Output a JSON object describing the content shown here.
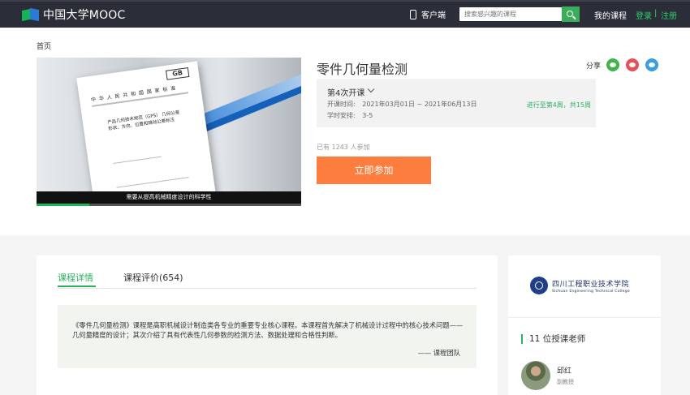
{
  "header": {
    "logo_text": "中国大学MOOC",
    "client_label": "客户端",
    "search_placeholder": "搜索感兴趣的课程",
    "my_courses": "我的课程",
    "login": "登录",
    "separator": "|",
    "register": "注册"
  },
  "breadcrumb": {
    "home": "首页"
  },
  "video": {
    "caption": "需要从提高机械精度设计的科学性",
    "progress_fraction": 0.2,
    "doc_badge": "GB",
    "doc_header": "中 华 人 民 共 和 国 国 家 标 准",
    "doc_subtitle": "产品几何技术规范（GPS） 几何公差 形状、方向、位置和跳动公差标注"
  },
  "course": {
    "title": "零件几何量检测",
    "share_label": "分享",
    "term_name": "第4次开课",
    "open_time_label": "开课时间:",
    "open_time_value": "2021年03月01日 ~ 2021年06月13日",
    "schedule_label": "学时安排:",
    "schedule_value": "3-5",
    "progress_text": "进行至第4周，共15周",
    "enrolled_text": "已有 1243 人参加",
    "join_button": "立即参加"
  },
  "tabs": {
    "detail": "课程详情",
    "reviews": "课程评价(654)"
  },
  "intro": {
    "text": "《零件几何量检测》课程是高职机械设计制造类各专业的重要专业核心课程。本课程首先解决了机械设计过程中的核心技术问题——几何量精度的设计；其次介绍了具有代表性几何参数的检测方法、数据处理和合格性判断。",
    "signature": "—— 课程团队"
  },
  "side": {
    "school_cn": "四川工程职业技术学院",
    "school_en": "Sichuan Engineering Technical College",
    "teacher_count": "11 位授课老师",
    "teacher_name": "邱红",
    "teacher_role": "副教授"
  },
  "colors": {
    "accent_green": "#2ab163",
    "join_orange": "#fc7d3e",
    "topbar": "#2b2d38"
  }
}
